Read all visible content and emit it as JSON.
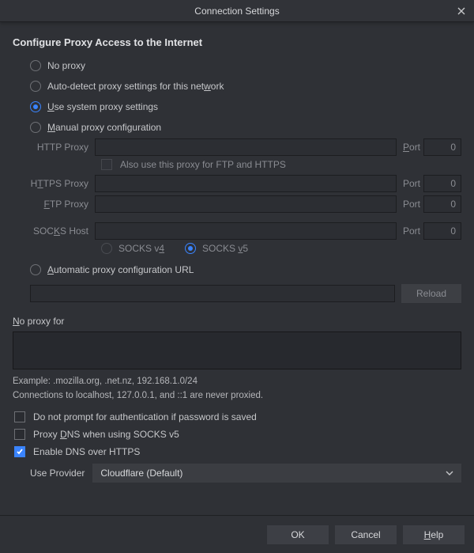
{
  "window": {
    "title": "Connection Settings"
  },
  "header": "Configure Proxy Access to the Internet",
  "proxy_mode": {
    "none": "No proxy",
    "auto_detect_pre": "Auto-detect proxy settings for this net",
    "auto_detect_u": "w",
    "auto_detect_post": "ork",
    "system_u": "U",
    "system_post": "se system proxy settings",
    "manual_u": "M",
    "manual_post": "anual proxy configuration",
    "auto_url_u": "A",
    "auto_url_post": "utomatic proxy configuration URL",
    "selected": "system"
  },
  "manual": {
    "http_label": "HTTP Proxy",
    "https_pre": "H",
    "https_u": "T",
    "https_post": "TPS Proxy",
    "ftp_u": "F",
    "ftp_post": "TP Proxy",
    "socks_pre": "SOC",
    "socks_u": "K",
    "socks_post": "S Host",
    "port_label_u": "P",
    "port_label_post": "ort",
    "port_label_plain": "Port",
    "also_use": "Also use this proxy for FTP and HTTPS",
    "http": {
      "host": "",
      "port": "0"
    },
    "https": {
      "host": "",
      "port": "0"
    },
    "ftp": {
      "host": "",
      "port": "0"
    },
    "socks": {
      "host": "",
      "port": "0"
    },
    "socks_version": {
      "v4_pre": "SOCKS v",
      "v4_u": "4",
      "v5_pre": "SOCKS ",
      "v5_u": "v",
      "v5_post": "5",
      "selected": "v5"
    }
  },
  "auto_url": {
    "value": "",
    "reload": "Reload"
  },
  "no_proxy": {
    "label_u": "N",
    "label_post": "o proxy for",
    "value": "",
    "example": "Example: .mozilla.org, .net.nz, 192.168.1.0/24",
    "localhost_note": "Connections to localhost, 127.0.0.1, and ::1 are never proxied."
  },
  "options": {
    "dont_prompt": "Do not prompt for authentication if password is saved",
    "proxy_dns_pre": "Proxy ",
    "proxy_dns_u": "D",
    "proxy_dns_post": "NS when using SOCKS v5",
    "enable_doh": "Enable DNS over HTTPS",
    "doh_checked": true,
    "provider_label": "Use Provider",
    "provider_value": "Cloudflare (Default)"
  },
  "footer": {
    "ok": "OK",
    "cancel": "Cancel",
    "help_u": "H",
    "help_post": "elp"
  }
}
